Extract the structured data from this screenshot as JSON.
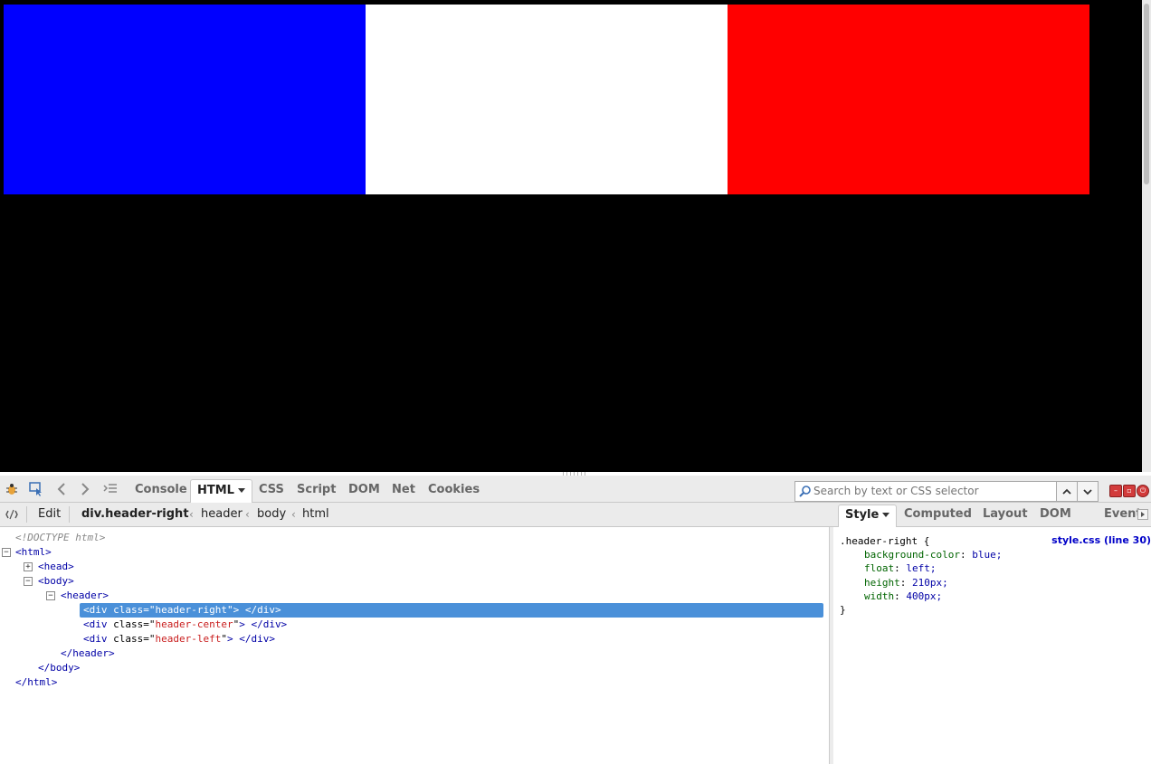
{
  "page": {
    "stripes": [
      {
        "color": "#0000ff"
      },
      {
        "color": "#ffffff"
      },
      {
        "color": "#ff0000"
      }
    ]
  },
  "firebug": {
    "tabs": [
      {
        "label": "Console",
        "selected": false
      },
      {
        "label": "HTML",
        "selected": true
      },
      {
        "label": "CSS",
        "selected": false
      },
      {
        "label": "Script",
        "selected": false
      },
      {
        "label": "DOM",
        "selected": false
      },
      {
        "label": "Net",
        "selected": false
      },
      {
        "label": "Cookies",
        "selected": false
      }
    ],
    "search": {
      "placeholder": "Search by text or CSS selector"
    },
    "subbar": {
      "edit_label": "Edit",
      "breadcrumbs": [
        "div.header-right",
        "header",
        "body",
        "html"
      ]
    },
    "side_tabs": [
      {
        "label": "Style",
        "selected": true
      },
      {
        "label": "Computed",
        "selected": false
      },
      {
        "label": "Layout",
        "selected": false
      },
      {
        "label": "DOM",
        "selected": false
      },
      {
        "label": "Events",
        "selected": false
      }
    ],
    "html_tree": {
      "doctype": "<!DOCTYPE html>",
      "html_open": "<html>",
      "head": "<head>",
      "body_open": "<body>",
      "header_open": "<header>",
      "divs": [
        {
          "cls": "header-right"
        },
        {
          "cls": "header-center"
        },
        {
          "cls": "header-left"
        }
      ],
      "div_open_pre": "<div ",
      "div_attr_name": "class=\"",
      "div_attr_close": "\"",
      "div_tail": "> </div>",
      "header_close": "</header>",
      "body_close": "</body>",
      "html_close": "</html>"
    },
    "style_rule": {
      "selector": ".header-right {",
      "source": "style.css (line 30)",
      "declarations": [
        {
          "prop": "background-color",
          "value": "blue;"
        },
        {
          "prop": "float",
          "value": "left;"
        },
        {
          "prop": "height",
          "value": "210px;"
        },
        {
          "prop": "width",
          "value": "400px;"
        }
      ],
      "close": "}"
    }
  }
}
